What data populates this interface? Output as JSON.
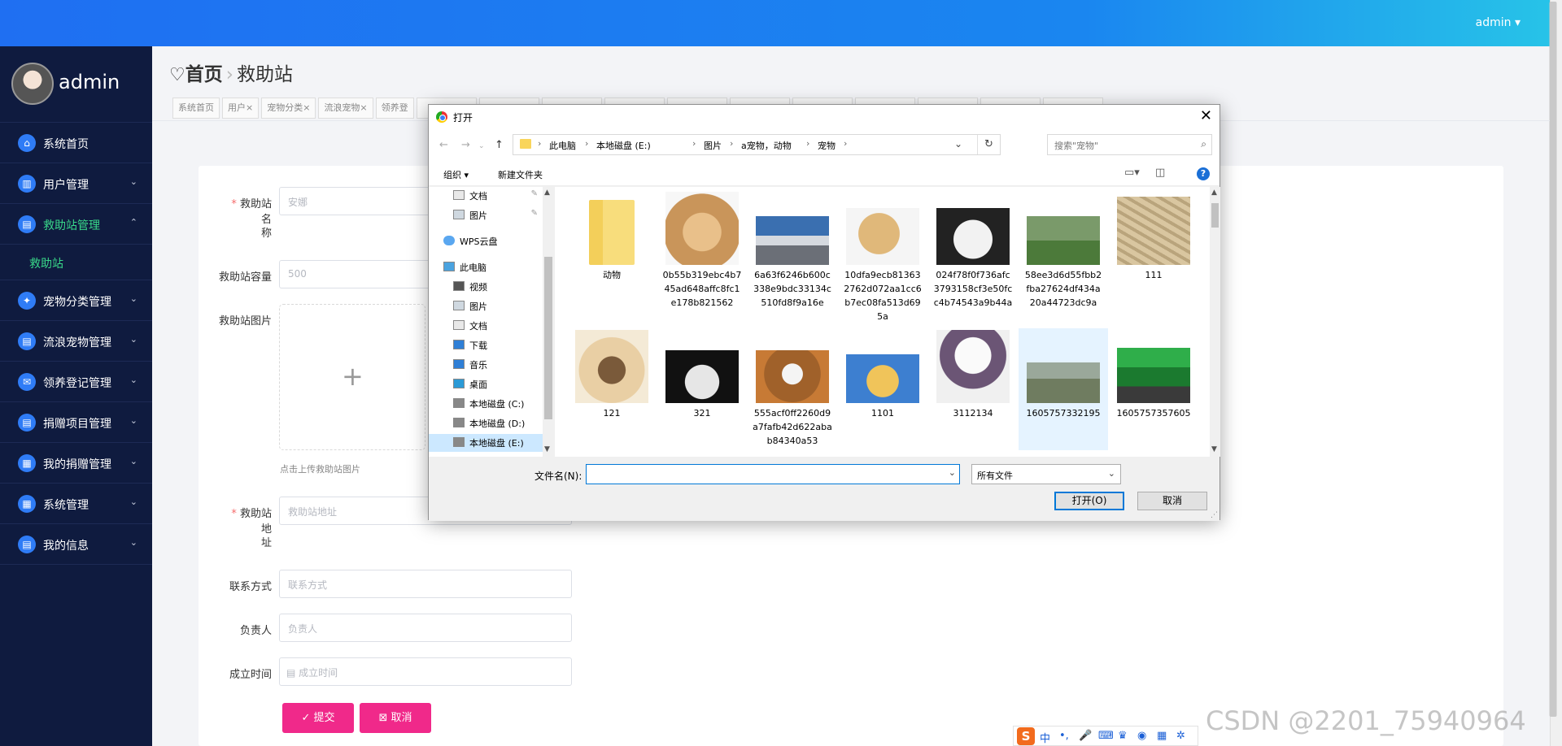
{
  "topbar": {
    "user": "admin ▾"
  },
  "sidebar": {
    "username": "admin",
    "items": [
      {
        "label": "系统首页",
        "icon": "home-icon",
        "glyph": "⌂",
        "chevron": ""
      },
      {
        "label": "用户管理",
        "icon": "users-icon",
        "glyph": "▥",
        "chevron": "⌄"
      },
      {
        "label": "救助站管理",
        "icon": "station-icon",
        "glyph": "▤",
        "chevron": "⌃"
      },
      {
        "label": "宠物分类管理",
        "icon": "pet-category-icon",
        "glyph": "✦",
        "chevron": "⌄"
      },
      {
        "label": "流浪宠物管理",
        "icon": "stray-pet-icon",
        "glyph": "▤",
        "chevron": "⌄"
      },
      {
        "label": "领养登记管理",
        "icon": "adoption-icon",
        "glyph": "✉",
        "chevron": "⌄"
      },
      {
        "label": "捐赠项目管理",
        "icon": "donation-project-icon",
        "glyph": "▤",
        "chevron": "⌄"
      },
      {
        "label": "我的捐赠管理",
        "icon": "my-donation-icon",
        "glyph": "▦",
        "chevron": "⌄"
      },
      {
        "label": "系统管理",
        "icon": "system-icon",
        "glyph": "▦",
        "chevron": "⌄"
      },
      {
        "label": "我的信息",
        "icon": "my-info-icon",
        "glyph": "▤",
        "chevron": "⌄"
      }
    ],
    "subitem": "救助站"
  },
  "breadcrumb": {
    "home": "首页",
    "current": "救助站"
  },
  "tabs": [
    "系统首页",
    "用户×",
    "宠物分类×",
    "流浪宠物×",
    "领养登"
  ],
  "form": {
    "name_label_1": "救助站名",
    "name_label_2": "称",
    "name_placeholder": "安娜",
    "capacity_label": "救助站容量",
    "capacity_placeholder": "500",
    "image_label": "救助站图片",
    "upload_hint": "点击上传救助站图片",
    "address_label_1": "救助站地",
    "address_label_2": "址",
    "address_placeholder": "救助站地址",
    "contact_label": "联系方式",
    "contact_placeholder": "联系方式",
    "manager_label": "负责人",
    "manager_placeholder": "负责人",
    "date_label": "成立时间",
    "date_placeholder": "成立时间",
    "submit": "✓ 提交",
    "cancel": "⊠ 取消"
  },
  "dialog": {
    "title": "打开",
    "path": [
      "此电脑",
      "本地磁盘 (E:)",
      "图片",
      "a宠物，动物",
      "宠物"
    ],
    "search_placeholder": "搜索\"宠物\"",
    "organize": "组织 ▾",
    "new_folder": "新建文件夹",
    "nav_items": [
      {
        "label": "文档",
        "icon": "document-icon",
        "pinned": true
      },
      {
        "label": "图片",
        "icon": "pictures-icon",
        "pinned": true
      },
      {
        "label": "WPS云盘",
        "icon": "cloud-icon",
        "pinned": false
      },
      {
        "label": "此电脑",
        "icon": "computer-icon",
        "pinned": false
      },
      {
        "label": "视频",
        "icon": "video-icon",
        "pinned": false
      },
      {
        "label": "图片",
        "icon": "pictures-icon",
        "pinned": false
      },
      {
        "label": "文档",
        "icon": "document-icon",
        "pinned": false
      },
      {
        "label": "下载",
        "icon": "download-icon",
        "pinned": false
      },
      {
        "label": "音乐",
        "icon": "music-icon",
        "pinned": false
      },
      {
        "label": "桌面",
        "icon": "desktop-icon",
        "pinned": false
      },
      {
        "label": "本地磁盘 (C:)",
        "icon": "drive-icon",
        "pinned": false
      },
      {
        "label": "本地磁盘 (D:)",
        "icon": "drive-icon",
        "pinned": false
      },
      {
        "label": "本地磁盘 (E:)",
        "icon": "drive-icon",
        "pinned": false
      }
    ],
    "files": [
      {
        "name": "动物",
        "kind": "folder"
      },
      {
        "name": "0b55b319ebc4b745ad648affc8fc1e178b821562",
        "kind": "dog"
      },
      {
        "name": "6a63f6246b600c338e9bdc33134c510fd8f9a16e",
        "kind": "husky"
      },
      {
        "name": "10dfa9ecb813632762d072aa1cc6b7ec08fa513d695a",
        "kind": "dog2"
      },
      {
        "name": "024f78f0f736afc3793158cf3e50fcc4b74543a9b44a",
        "kind": "cat"
      },
      {
        "name": "58ee3d6d55fbb2fba27624df434a20a44723dc9a",
        "kind": "husky2"
      },
      {
        "name": "111",
        "kind": "pellets"
      },
      {
        "name": "121",
        "kind": "catbed"
      },
      {
        "name": "321",
        "kind": "kitten"
      },
      {
        "name": "555acf0ff2260d9a7fafb42d622abab84340a53",
        "kind": "dog3"
      },
      {
        "name": "1101",
        "kind": "shiba"
      },
      {
        "name": "3112134",
        "kind": "poodle"
      },
      {
        "name": "1605757332195",
        "kind": "shop"
      },
      {
        "name": "1605757357605",
        "kind": "store"
      }
    ],
    "filename_label": "文件名(N):",
    "filetype": "所有文件",
    "open": "打开(O)",
    "cancel": "取消"
  },
  "ime": {
    "s": "S",
    "glyphs": [
      "中",
      "•,",
      "🎤",
      "⌨",
      "♛",
      "◉",
      "▦",
      "✲"
    ]
  },
  "watermark": "CSDN @2201_75940964"
}
